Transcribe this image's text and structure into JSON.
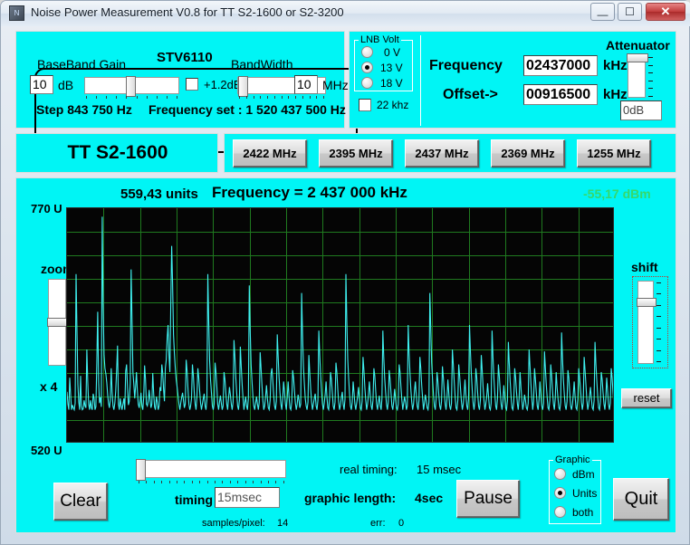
{
  "window": {
    "title": "Noise Power Measurement V0.8 for TT S2-1600 or S2-3200",
    "app_icon": "app-icon",
    "minimize": "–",
    "maximize": "❐",
    "close": "✕"
  },
  "colors": {
    "panel": "#00f5f5",
    "graph_bg": "#050505",
    "grid": "#1f7a1f",
    "trace": "#3ff0f0",
    "dbm_text": "#35d96b",
    "close_red": "#c23c3c"
  },
  "tuner_group": {
    "title": "STV6110",
    "baseband_gain_label": "BaseBand Gain",
    "baseband_gain_value": "10",
    "baseband_gain_unit": "dB",
    "gain_trim_checkbox_label": "+1.2dB",
    "bandwidth_label": "BandWidth",
    "bandwidth_value": "10",
    "bandwidth_unit": "MHz",
    "step_label": "Step  843 750 Hz",
    "frequency_set_label": "Frequency set : 1 520 437 500 Hz"
  },
  "lnb": {
    "group_label": "LNB Volt",
    "options": [
      "0 V",
      "13 V",
      "18 V"
    ],
    "selected": "13 V",
    "tone_label": "22 khz",
    "tone_checked": false
  },
  "frequency_panel": {
    "frequency_label": "Frequency",
    "frequency_value": "02437000",
    "frequency_unit": "kHz",
    "offset_label": "Offset->",
    "offset_value": "00916500",
    "offset_unit": "kHz"
  },
  "attenuator": {
    "label": "Attenuator",
    "value": "0dB"
  },
  "device": {
    "name": "TT S2-1600"
  },
  "presets": [
    {
      "label": "2422 MHz"
    },
    {
      "label": "2395 MHz"
    },
    {
      "label": "2437 MHz"
    },
    {
      "label": "2369 MHz"
    },
    {
      "label": "1255 MHz"
    }
  ],
  "readout": {
    "units_value": "559,43 units",
    "frequency_readout": "Frequency =  2 437 000 kHz",
    "dbm_value": "-55,17 dBm",
    "axis_top": "770 U",
    "axis_bottom": "520 U"
  },
  "zoom_control": {
    "label": "zoom",
    "factor": "x 4"
  },
  "shift_control": {
    "label": "shift",
    "reset_label": "reset"
  },
  "bottom": {
    "clear_label": "Clear",
    "timing_label": "timing",
    "timing_value": "15msec",
    "real_timing_label": "real timing:",
    "real_timing_value": "15 msec",
    "graphic_length_label": "graphic length:",
    "graphic_length_value": "4sec",
    "samples_label": "samples/pixel:",
    "samples_value": "14",
    "err_label": "err:",
    "err_value": "0",
    "pause_label": "Pause",
    "quit_label": "Quit"
  },
  "graphic_mode": {
    "group_label": "Graphic",
    "options": [
      "dBm",
      "Units",
      "both"
    ],
    "selected": "Units"
  },
  "chart_data": {
    "type": "line",
    "title": "Frequency =  2 437 000 kHz",
    "ylabel": "units",
    "xlabel": "",
    "ylim": [
      520,
      770
    ],
    "ytick_labels": [
      "770 U",
      "520 U"
    ],
    "grid": true,
    "grid_cols": 15,
    "grid_rows": 10,
    "legend": "none",
    "series": [
      {
        "name": "noise power",
        "color": "#3ff0f0",
        "values": [
          575,
          562,
          556,
          590,
          572,
          556,
          561,
          558,
          556,
          563,
          700,
          640,
          583,
          564,
          556,
          592,
          560,
          556,
          557,
          566,
          560,
          558,
          620,
          586,
          562,
          556,
          566,
          558,
          556,
          573,
          568,
          556,
          559,
          605,
          660,
          585,
          563,
          569,
          559,
          761,
          668,
          614,
          600,
          594,
          585,
          572,
          563,
          558,
          566,
          600,
          575,
          560,
          556,
          563,
          576,
          598,
          624,
          562,
          556,
          568,
          560,
          556,
          562,
          568,
          556,
          597,
          604,
          580,
          561,
          565,
          584,
          705,
          650,
          596,
          583,
          568,
          580,
          596,
          576,
          562,
          558,
          565,
          574,
          560,
          556,
          569,
          603,
          588,
          562,
          560,
          565,
          577,
          567,
          558,
          562,
          595,
          573,
          559,
          556,
          570,
          564,
          556,
          560,
          580,
          576,
          604,
          595,
          578,
          565,
          600,
          609,
          632,
          646,
          614,
          596,
          668,
          730,
          690,
          636,
          616,
          600,
          588,
          580,
          571,
          562,
          556,
          563,
          569,
          574,
          566,
          558,
          562,
          609,
          597,
          578,
          562,
          556,
          560,
          568,
          604,
          593,
          575,
          562,
          556,
          570,
          600,
          590,
          576,
          563,
          556,
          562,
          568,
          573,
          560,
          556,
          567,
          700,
          650,
          608,
          588,
          574,
          560,
          556,
          562,
          606,
          596,
          580,
          562,
          556,
          564,
          571,
          563,
          556,
          560,
          596,
          588,
          574,
          562,
          556,
          568,
          580,
          572,
          562,
          556,
          564,
          630,
          612,
          590,
          574,
          560,
          556,
          566,
          623,
          602,
          583,
          568,
          556,
          563,
          570,
          560,
          556,
          568,
          688,
          640,
          604,
          586,
          570,
          560,
          556,
          563,
          570,
          562,
          556,
          564,
          617,
          600,
          582,
          566,
          556,
          560,
          570,
          582,
          568,
          558,
          556,
          566,
          594,
          600,
          588,
          572,
          560,
          556,
          565,
          636,
          612,
          590,
          574,
          562,
          556,
          568,
          586,
          575,
          562,
          556,
          569,
          586,
          570,
          558,
          556,
          564,
          598,
          590,
          576,
          563,
          556,
          562,
          572,
          566,
          558,
          562,
          680,
          636,
          602,
          584,
          568,
          560,
          556,
          564,
          614,
          595,
          578,
          564,
          556,
          562,
          568,
          573,
          560,
          556,
          566,
          640,
          614,
          592,
          576,
          562,
          556,
          563,
          572,
          586,
          570,
          558,
          556,
          568,
          596,
          588,
          574,
          560,
          556,
          564,
          606,
          596,
          578,
          564,
          556,
          561,
          569,
          575,
          562,
          556,
          567,
          700,
          650,
          610,
          590,
          573,
          560,
          556,
          564,
          586,
          574,
          562,
          556,
          563,
          570,
          580,
          568,
          558,
          556,
          565,
          612,
          598,
          580,
          566,
          556,
          562,
          572,
          586,
          572,
          560,
          556,
          566,
          600,
          592,
          576,
          562,
          556,
          564,
          571,
          560,
          556,
          568,
          640,
          612,
          590,
          575,
          562,
          556,
          564,
          598,
          588,
          574,
          560,
          556,
          565,
          578,
          568,
          558,
          556,
          562,
          604,
          596,
          580,
          566,
          556,
          563,
          570,
          564,
          556,
          560,
          646,
          618,
          596,
          578,
          564,
          556,
          562,
          576,
          586,
          572,
          560,
          556,
          566,
          612,
          600,
          582,
          568,
          556,
          563,
          572,
          566,
          558,
          556,
          564,
          680,
          642,
          606,
          588,
          572,
          560,
          556,
          568,
          596,
          586,
          572,
          560,
          556,
          565,
          602,
          590,
          576,
          562,
          556,
          567,
          588,
          574,
          560,
          556,
          563,
          620,
          604,
          586,
          570,
          558,
          556,
          566,
          604,
          592,
          578,
          564,
          556,
          562,
          572,
          588,
          572,
          560,
          556,
          568,
          646,
          618,
          594,
          577,
          563,
          556,
          565,
          600,
          590,
          574,
          560,
          556,
          566,
          614,
          598,
          580,
          566,
          556,
          562,
          570,
          584,
          570,
          558,
          556,
          563,
          640,
          612,
          590,
          574,
          560,
          556,
          568,
          604,
          592,
          576,
          562,
          556,
          565,
          582,
          570,
          558,
          556,
          566,
          628,
          606,
          586,
          570,
          558,
          556,
          564,
          600,
          590,
          575,
          562,
          556,
          568,
          596,
          580,
          566,
          556,
          562,
          572,
          566,
          558,
          556,
          563,
          620,
          602,
          584,
          568,
          556,
          565,
          600,
          588,
          574,
          560,
          556,
          567,
          586,
          572,
          560,
          556,
          563,
          618,
          600,
          584,
          570,
          558,
          556,
          566,
          604,
          592,
          576,
          562,
          556,
          568,
          596,
          580,
          568,
          558,
          556,
          564,
          638,
          610,
          588,
          572,
          560,
          556,
          565,
          598,
          590,
          574,
          560,
          556,
          562,
          572,
          586,
          570,
          558,
          556,
          567,
          600,
          590,
          578,
          564,
          556,
          563,
          612,
          598,
          582,
          566,
          556,
          562,
          570,
          580,
          568,
          558,
          556,
          566,
          628,
          604,
          586,
          570,
          558,
          556,
          564,
          596,
          588,
          574,
          562,
          556,
          568,
          590,
          576,
          562,
          556,
          563,
          600,
          590,
          574,
          560
        ]
      }
    ]
  }
}
